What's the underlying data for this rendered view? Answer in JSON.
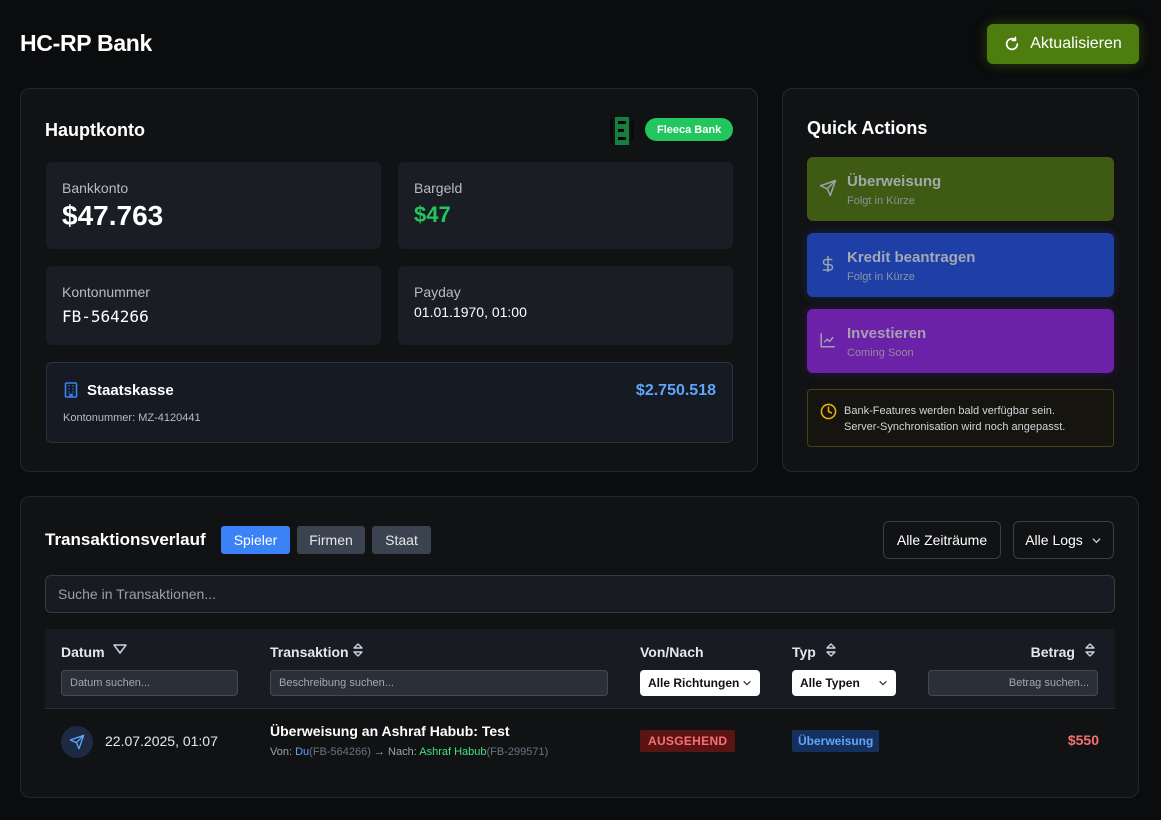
{
  "header": {
    "title": "HC-RP Bank",
    "refresh_label": "Aktualisieren",
    "accent": "#4d7c0f"
  },
  "main_account": {
    "title": "Hauptkonto",
    "bank_badge": "Fleeca Bank",
    "badge_color": "#22c55e",
    "bank_label": "Bankkonto",
    "bank_value": "$47.763",
    "cash_label": "Bargeld",
    "cash_value": "$47",
    "account_number_label": "Kontonummer",
    "account_number_value": "FB-564266",
    "payday_label": "Payday",
    "payday_value": "01.01.1970, 01:00",
    "treasury": {
      "title": "Staatskasse",
      "account_number": "Kontonummer: MZ-4120441",
      "amount": "$2.750.518"
    }
  },
  "quick_actions": {
    "title": "Quick Actions",
    "items": [
      {
        "title": "Überweisung",
        "subtitle": "Folgt in Kürze",
        "icon": "send-icon",
        "color": "#3f5a12"
      },
      {
        "title": "Kredit beantragen",
        "subtitle": "Folgt in Kürze",
        "icon": "dollar-icon",
        "color": "#1e40af"
      },
      {
        "title": "Investieren",
        "subtitle": "Coming Soon",
        "icon": "chart-icon",
        "color": "#6b21a8"
      }
    ],
    "notice_line1": "Bank-Features werden bald verfügbar sein.",
    "notice_line2": "Server-Synchronisation wird noch angepasst."
  },
  "transactions": {
    "title": "Transaktionsverlauf",
    "tabs": [
      {
        "label": "Spieler",
        "active": true
      },
      {
        "label": "Firmen",
        "active": false
      },
      {
        "label": "Staat",
        "active": false
      }
    ],
    "period_filter": "Alle Zeiträume",
    "log_filter": "Alle Logs",
    "search_placeholder": "Suche in Transaktionen...",
    "columns": {
      "date": "Datum",
      "transaction": "Transaktion",
      "direction": "Von/Nach",
      "type": "Typ",
      "amount": "Betrag"
    },
    "filters": {
      "date_placeholder": "Datum suchen...",
      "description_placeholder": "Beschreibung suchen...",
      "direction_value": "Alle Richtungen",
      "type_value": "Alle Typen",
      "amount_placeholder": "Betrag suchen..."
    },
    "rows": [
      {
        "date": "22.07.2025, 01:07",
        "title": "Überweisung an Ashraf Habub: Test",
        "from_label": "Von:",
        "from_name": "Du",
        "from_account": "(FB-564266)",
        "arrow": "→",
        "to_label": "Nach:",
        "to_name": "Ashraf Habub",
        "to_account": "(FB-299571)",
        "direction": "AUSGEHEND",
        "type": "Überweisung",
        "amount": "$550"
      }
    ]
  }
}
